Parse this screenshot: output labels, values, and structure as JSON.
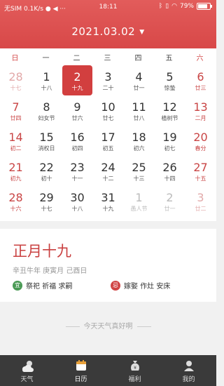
{
  "status_bar": {
    "carrier": "无SIM",
    "speed": "0.1K/s",
    "time": "18:11",
    "battery_percent": "79%",
    "battery_level": 0.79,
    "icons": [
      "wechat-icon",
      "mute-icon",
      "more-icon",
      "bluetooth-icon",
      "vibrate-icon",
      "wifi-icon",
      "battery-icon"
    ]
  },
  "header": {
    "date": "2021.03.02",
    "caret": "▼",
    "accent_color": "#d84848"
  },
  "weekdays": [
    "日",
    "一",
    "二",
    "三",
    "四",
    "五",
    "六"
  ],
  "weeks": [
    [
      {
        "day": "28",
        "lunar": "十七",
        "other": true
      },
      {
        "day": "1",
        "lunar": "十八"
      },
      {
        "day": "2",
        "lunar": "十九",
        "selected": true
      },
      {
        "day": "3",
        "lunar": "二十"
      },
      {
        "day": "4",
        "lunar": "廿一"
      },
      {
        "day": "5",
        "lunar": "惊蛰",
        "festival": false
      },
      {
        "day": "6",
        "lunar": "廿三"
      }
    ],
    [
      {
        "day": "7",
        "lunar": "廿四"
      },
      {
        "day": "8",
        "lunar": "妇女节"
      },
      {
        "day": "9",
        "lunar": "廿六"
      },
      {
        "day": "10",
        "lunar": "廿七"
      },
      {
        "day": "11",
        "lunar": "廿八"
      },
      {
        "day": "12",
        "lunar": "植树节"
      },
      {
        "day": "13",
        "lunar": "二月"
      }
    ],
    [
      {
        "day": "14",
        "lunar": "初二"
      },
      {
        "day": "15",
        "lunar": "消权日"
      },
      {
        "day": "16",
        "lunar": "初四"
      },
      {
        "day": "17",
        "lunar": "初五"
      },
      {
        "day": "18",
        "lunar": "初六"
      },
      {
        "day": "19",
        "lunar": "初七"
      },
      {
        "day": "20",
        "lunar": "春分"
      }
    ],
    [
      {
        "day": "21",
        "lunar": "初九"
      },
      {
        "day": "22",
        "lunar": "初十"
      },
      {
        "day": "23",
        "lunar": "十一"
      },
      {
        "day": "24",
        "lunar": "十二"
      },
      {
        "day": "25",
        "lunar": "十三"
      },
      {
        "day": "26",
        "lunar": "十四"
      },
      {
        "day": "27",
        "lunar": "十五"
      }
    ],
    [
      {
        "day": "28",
        "lunar": "十六"
      },
      {
        "day": "29",
        "lunar": "十七"
      },
      {
        "day": "30",
        "lunar": "十八"
      },
      {
        "day": "31",
        "lunar": "十九"
      },
      {
        "day": "1",
        "lunar": "愚人节",
        "other": true
      },
      {
        "day": "2",
        "lunar": "廿一",
        "other": true
      },
      {
        "day": "3",
        "lunar": "廿二",
        "other": true
      }
    ]
  ],
  "day_info": {
    "lunar_date": "正月十九",
    "ganzhi": "辛丑牛年 庚寅月 己酉日",
    "yi_badge": "宜",
    "yi_text": "祭祀 祈福 求嗣",
    "ji_badge": "忌",
    "ji_text": "嫁娶 作灶 安床"
  },
  "motto": "今天天气真好啊",
  "tabs": [
    {
      "label": "天气",
      "icon": "weather-icon",
      "active": false
    },
    {
      "label": "日历",
      "icon": "calendar-icon",
      "active": true
    },
    {
      "label": "福利",
      "icon": "money-bag-icon",
      "active": false
    },
    {
      "label": "我的",
      "icon": "user-icon",
      "active": false
    }
  ]
}
